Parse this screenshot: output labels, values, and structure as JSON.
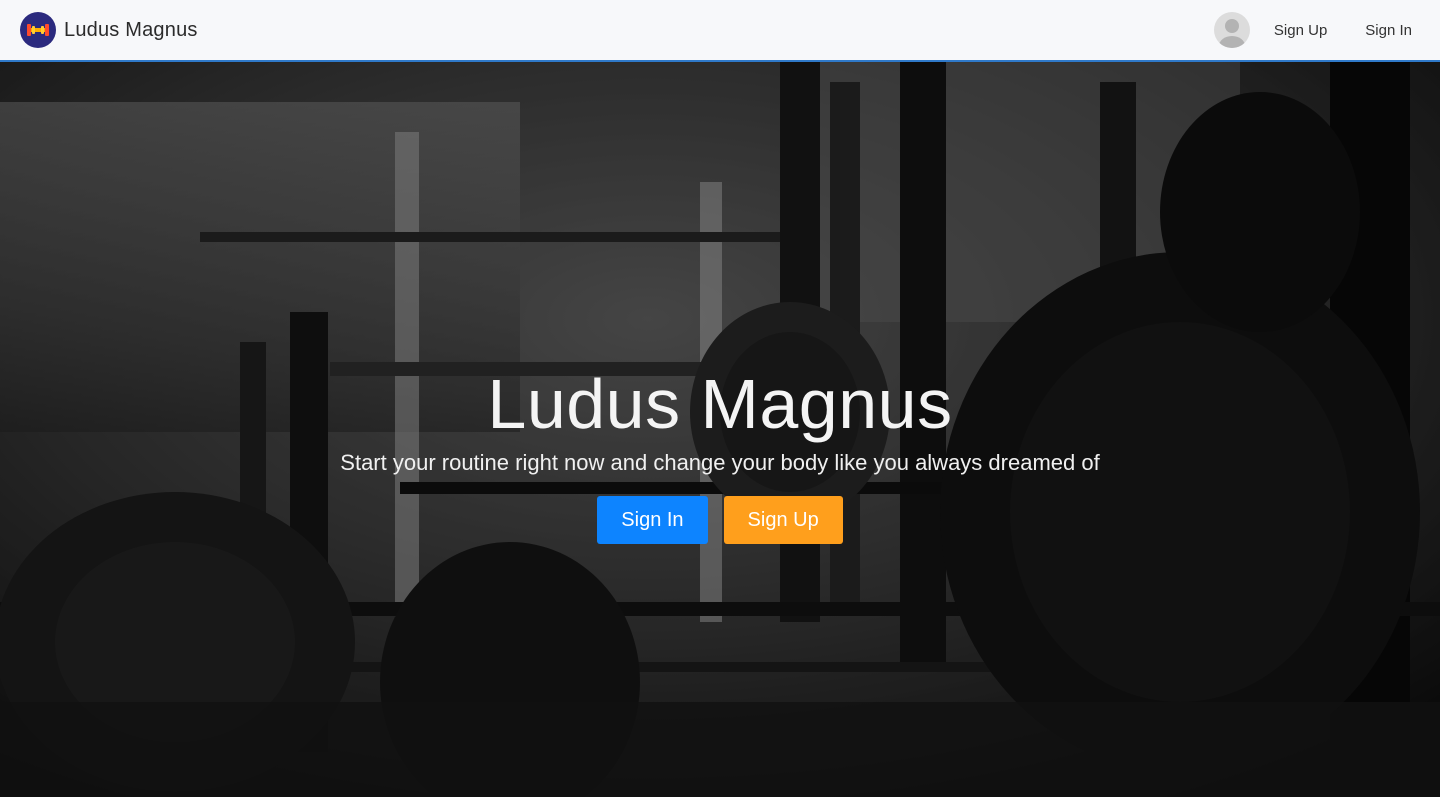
{
  "navbar": {
    "brand_name": "Ludus Magnus",
    "logo_icon": "dumbbell-icon",
    "avatar_icon": "user-avatar-icon",
    "links": [
      {
        "label": "Sign Up"
      },
      {
        "label": "Sign In"
      }
    ],
    "border_color": "#2f79c9"
  },
  "hero": {
    "title": "Ludus Magnus",
    "subtitle": "Start your routine right now and change your body like you always dreamed of",
    "background_image": "gym-barbell-photo",
    "buttons": {
      "signin_label": "Sign In",
      "signup_label": "Sign Up"
    },
    "colors": {
      "signin": "#0d84ff",
      "signup": "#ff9f1c"
    }
  }
}
